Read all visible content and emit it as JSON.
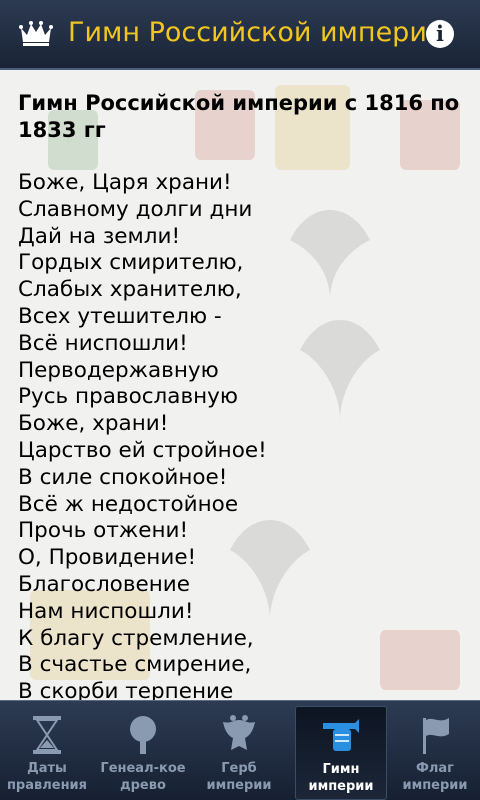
{
  "app": {
    "title": "Гимн Российской империи",
    "icons": {
      "logo": "crown-icon",
      "info": "info-icon"
    },
    "info_glyph": "i",
    "colors": {
      "title": "#f2c61f",
      "bar": "#1a2436",
      "active_icon": "#2a8fe0"
    }
  },
  "content": {
    "heading": "Гимн Российской империи с 1816 по 1833 гг",
    "lines": [
      "Боже, Царя храни!",
      "Славному долги дни",
      "Дай на земли!",
      "Гордых смирителю,",
      "Слабых хранителю,",
      "Всех утешителю -",
      "Всё ниспошли!",
      "Перводержавную",
      "Русь православную",
      "Боже, храни!",
      "Царство ей стройное!",
      "В силе спокойное!",
      "Всё ж недостойное",
      "Прочь отжени!",
      "О, Провидение!",
      "Благословение",
      "Нам ниспошли!",
      "К благу стремление,",
      "В счастье смирение,",
      "В скорби терпение"
    ]
  },
  "tabs": [
    {
      "line1": "Даты",
      "line2": "правления",
      "icon": "hourglass-icon",
      "active": false
    },
    {
      "line1": "Генеал-кое",
      "line2": "древо",
      "icon": "tree-icon",
      "active": false
    },
    {
      "line1": "Герб",
      "line2": "империи",
      "icon": "coat-of-arms-icon",
      "active": false
    },
    {
      "line1": "Гимн",
      "line2": "империи",
      "icon": "trumpet-icon",
      "active": true
    },
    {
      "line1": "Флаг",
      "line2": "империи",
      "icon": "flag-icon",
      "active": false
    }
  ]
}
